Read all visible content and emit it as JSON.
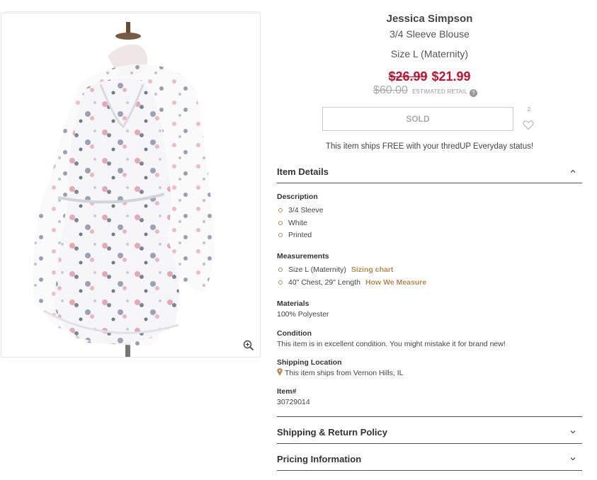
{
  "product": {
    "brand": "Jessica Simpson",
    "name": "3/4 Sleeve Blouse",
    "size": "Size L (Maternity)",
    "price_old": "$26.99",
    "price_new": "$21.99",
    "retail_price": "$60.00",
    "retail_label": "ESTIMATED RETAIL",
    "help_glyph": "?",
    "sold_label": "SOLD",
    "favorites_count": "2",
    "shipping_message": "This item ships FREE  with your thredUP Everyday status!"
  },
  "item_details": {
    "title": "Item Details",
    "description_label": "Description",
    "description_items": [
      "3/4 Sleeve",
      "White",
      "Printed"
    ],
    "measurements_label": "Measurements",
    "measurements": [
      {
        "text": "Size L (Maternity)",
        "link": "Sizing chart"
      },
      {
        "text": "40\" Chest, 29\" Length",
        "link": "How We Measure"
      }
    ],
    "materials_label": "Materials",
    "materials_value": "100% Polyester",
    "condition_label": "Condition",
    "condition_value": "This item is in excellent condition. You might mistake it for brand new!",
    "shipping_location_label": "Shipping Location",
    "shipping_location_value": "This item ships from Vernon Hills, IL",
    "item_number_label": "Item#",
    "item_number_value": "30729014"
  },
  "sections": {
    "shipping_return": "Shipping & Return Policy",
    "pricing_info": "Pricing Information"
  },
  "icons": {
    "zoom": "zoom-in-icon",
    "heart": "heart-icon",
    "chevron_up": "chevron-up-icon",
    "chevron_down": "chevron-down-icon",
    "pin": "location-pin-icon"
  },
  "colors": {
    "price_red": "#c8102e",
    "link_gold": "#b68b4c",
    "retail_gray": "#aaaaaa"
  }
}
